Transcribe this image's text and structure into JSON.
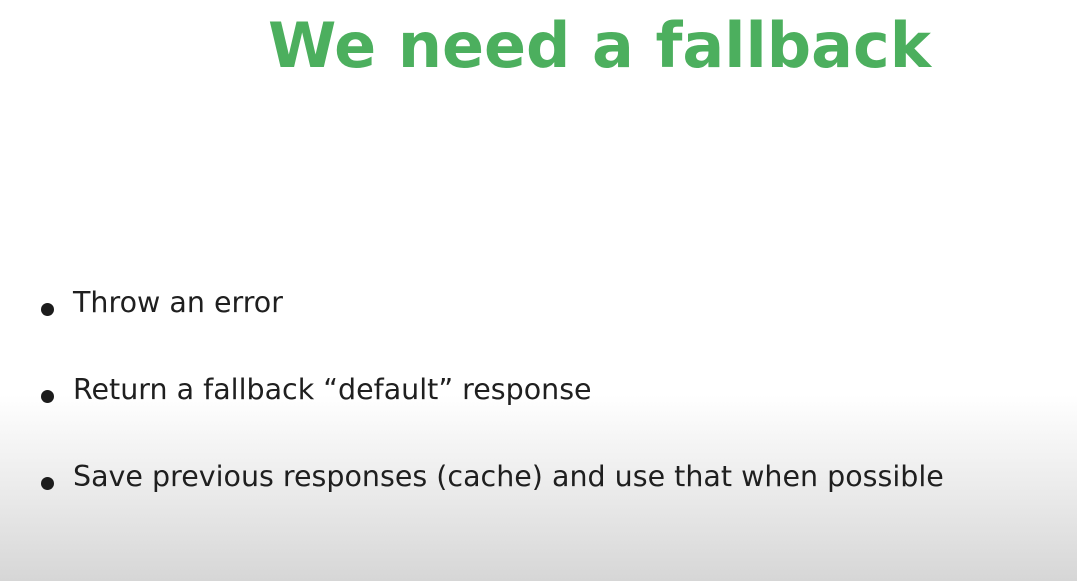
{
  "slide": {
    "title": "We need a fallback",
    "bullets": [
      "Throw an error",
      "Return a fallback “default” response",
      "Save previous responses (cache) and use that when possible"
    ]
  },
  "colors": {
    "title": "#4caf5e",
    "text": "#1f1f1f",
    "background": "#ffffff"
  }
}
